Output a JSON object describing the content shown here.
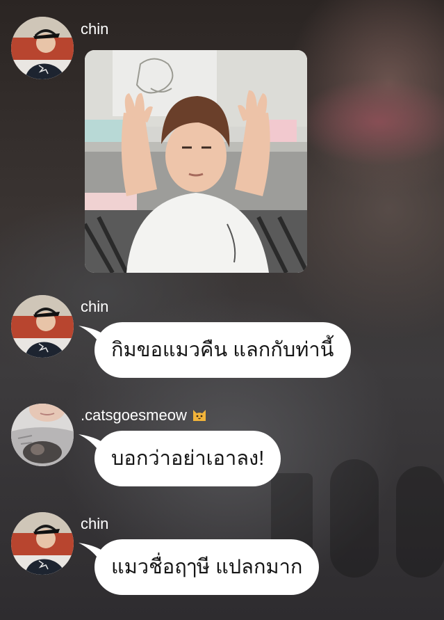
{
  "messages": [
    {
      "username": "chin",
      "type": "image",
      "image": "photo-person-hands-up-ears"
    },
    {
      "username": "chin",
      "type": "text",
      "text": "กิมขอแมวคืน แลกกับท่านี้"
    },
    {
      "username": ".catsgoesmeow",
      "badge": "cat-emoji-icon",
      "type": "text",
      "text": "บอกว่าอย่าเอาลง!"
    },
    {
      "username": "chin",
      "type": "text",
      "text": "แมวชื่อฤๅษี แปลกมาก"
    }
  ],
  "colors": {
    "bubble": "#ffffff",
    "bubble_text": "#151515",
    "username_text": "#ffffff",
    "badge": "#f2b43a"
  }
}
